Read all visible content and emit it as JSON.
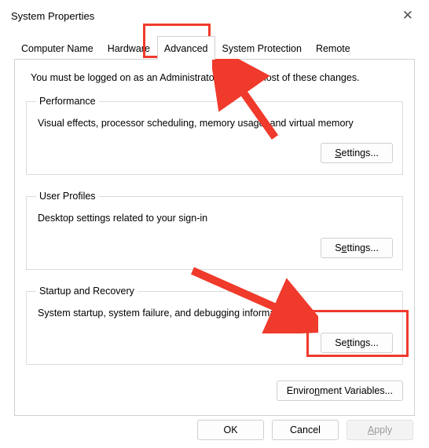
{
  "window": {
    "title": "System Properties",
    "close": "✕"
  },
  "tabs": {
    "computer_name": "Computer Name",
    "hardware": "Hardware",
    "advanced": "Advanced",
    "system_protection": "System Protection",
    "remote": "Remote"
  },
  "content": {
    "intro": "You must be logged on as an Administrator to make most of these changes."
  },
  "groups": {
    "performance": {
      "legend": "Performance",
      "desc": "Visual effects, processor scheduling, memory usage, and virtual memory"
    },
    "user_profiles": {
      "legend": "User Profiles",
      "desc": "Desktop settings related to your sign-in"
    },
    "startup": {
      "legend": "Startup and Recovery",
      "desc": "System startup, system failure, and debugging information"
    }
  },
  "buttons": {
    "settings_s": {
      "pre": "",
      "u": "S",
      "post": "ettings..."
    },
    "settings_e": {
      "pre": "S",
      "u": "e",
      "post": "ttings..."
    },
    "settings_t": {
      "pre": "Se",
      "u": "t",
      "post": "tings..."
    },
    "env": {
      "pre": "Enviro",
      "u": "n",
      "post": "ment Variables..."
    },
    "ok": "OK",
    "cancel": "Cancel",
    "apply": {
      "u": "A",
      "post": "pply"
    }
  }
}
